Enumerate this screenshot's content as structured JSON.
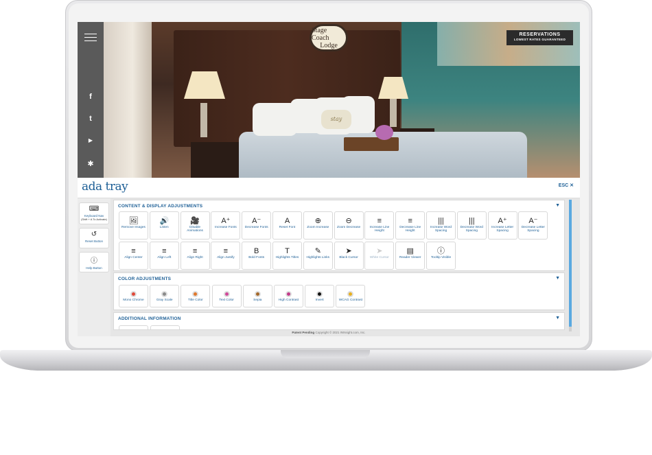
{
  "hero": {
    "logo_line1": "Stage Coach",
    "logo_line2": "Lodge",
    "reservations_title": "RESERVATIONS",
    "reservations_sub": "LOWEST RATES GUARANTEED",
    "pillow_text": "stay"
  },
  "sidebar": {
    "social": [
      {
        "name": "facebook",
        "glyph": "f"
      },
      {
        "name": "twitter",
        "glyph": "t"
      },
      {
        "name": "youtube",
        "glyph": "▶"
      },
      {
        "name": "yelp",
        "glyph": "✱"
      }
    ]
  },
  "tray": {
    "brand": "ada tray",
    "esc": "ESC ✕"
  },
  "side_buttons": {
    "keyboard": {
      "label": "Keyboard Nav",
      "sub": "(Shift + A To Activate)"
    },
    "reset": {
      "label": "Reset Button"
    },
    "help": {
      "label": "Help Button"
    }
  },
  "sections": {
    "content": {
      "title": "CONTENT & DISPLAY ADJUSTMENTS",
      "row1": [
        {
          "label": "Remove Images",
          "icon": "🖼"
        },
        {
          "label": "Listen",
          "icon": "🔊"
        },
        {
          "label": "Disable Animations",
          "icon": "🎥"
        },
        {
          "label": "Increase Fonts",
          "icon": "A⁺"
        },
        {
          "label": "Decrease Fonts",
          "icon": "A⁻"
        },
        {
          "label": "Reset Font",
          "icon": "A"
        },
        {
          "label": "Zoom Increase",
          "icon": "⊕"
        },
        {
          "label": "Zoom Decrease",
          "icon": "⊖"
        },
        {
          "label": "Increase Line Height",
          "icon": "≡"
        },
        {
          "label": "Decrease Line Height",
          "icon": "≡"
        },
        {
          "label": "Increase Word Spacing",
          "icon": "|||"
        },
        {
          "label": "Decrease Word Spacing",
          "icon": "|||"
        },
        {
          "label": "Increase Letter Spacing",
          "icon": "A⁺"
        },
        {
          "label": "Decrease Letter Spacing",
          "icon": "A⁻"
        }
      ],
      "row2": [
        {
          "label": "Align Center",
          "icon": "≡"
        },
        {
          "label": "Align Left",
          "icon": "≡"
        },
        {
          "label": "Align Right",
          "icon": "≡"
        },
        {
          "label": "Align Justify",
          "icon": "≡"
        },
        {
          "label": "Bold Fonts",
          "icon": "B"
        },
        {
          "label": "Highlights Titles",
          "icon": "T"
        },
        {
          "label": "Highlights Links",
          "icon": "✎"
        },
        {
          "label": "Black Cursor",
          "icon": "➤"
        },
        {
          "label": "White Cursor",
          "icon": "➤"
        },
        {
          "label": "Reader Viewer",
          "icon": "▤"
        },
        {
          "label": "Tooltip Visible",
          "icon": "ⓘ"
        }
      ]
    },
    "color": {
      "title": "COLOR ADJUSTMENTS",
      "tiles": [
        {
          "label": "Mono Chrome",
          "color": "#e04a3a"
        },
        {
          "label": "Gray Scale",
          "color": "#8a8a8a"
        },
        {
          "label": "Title Color",
          "color": "#e0782c"
        },
        {
          "label": "Text Color",
          "color": "#d04a9a"
        },
        {
          "label": "Sepia",
          "color": "#a5692a"
        },
        {
          "label": "High Contrast",
          "color": "#c43a8a"
        },
        {
          "label": "Invert",
          "color": "#111111"
        },
        {
          "label": "WCAG Contrast",
          "color": "#e8b020"
        }
      ]
    },
    "additional": {
      "title": "ADDITIONAL INFORMATION"
    }
  },
  "footer": {
    "bold": "Patent Pending",
    "rest": "Copyright © 2021 INNsight.com, Inc."
  }
}
